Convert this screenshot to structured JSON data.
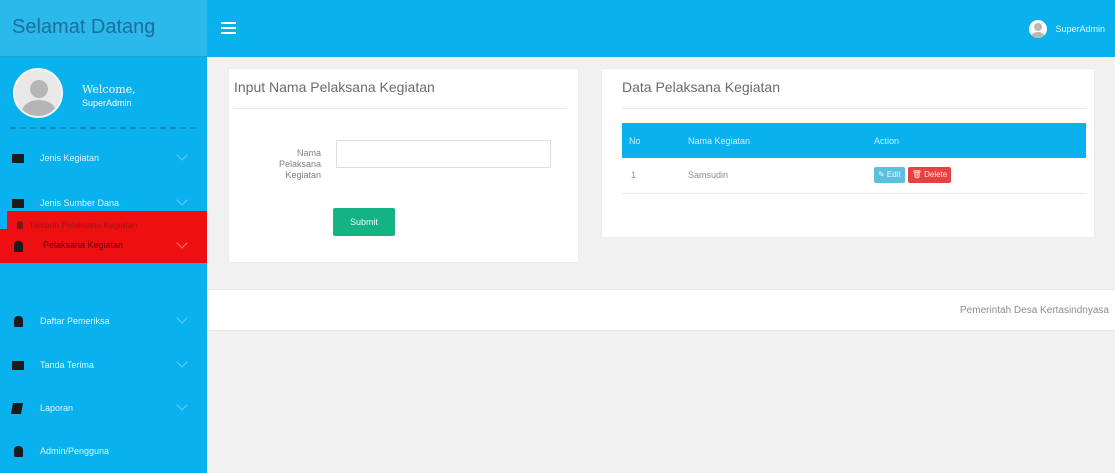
{
  "brand": {
    "title": "Selamat Datang"
  },
  "header": {
    "user_name": "SuperAdmin"
  },
  "sidebar": {
    "welcome": "Welcome,",
    "user_name": "SuperAdmin",
    "items": [
      {
        "label": "Jenis Kegiatan"
      },
      {
        "label": "Jenis Sumber Dana"
      },
      {
        "label": "Pelaksana Kegiatan"
      },
      {
        "label": "Daftar Pemeriksa"
      },
      {
        "label": "Tanda Terima"
      },
      {
        "label": "Laporan"
      },
      {
        "label": "Admin/Pengguna"
      }
    ],
    "subitem": {
      "label": "Tambah Pelaksana Kegiatan"
    }
  },
  "form_panel": {
    "title": "Input Nama Pelaksana Kegiatan",
    "field_label_1": "Nama",
    "field_label_2": "Pelaksana",
    "field_label_3": "Kegiatan",
    "field_value": "",
    "submit_label": "Submit"
  },
  "data_panel": {
    "title": "Data Pelaksana Kegiatan",
    "columns": [
      "No",
      "Nama Kegiatan",
      "Action"
    ],
    "rows": [
      {
        "no": "1",
        "name": "Samsudin",
        "edit": "✎ Edit",
        "delete": "🗑 Delete"
      }
    ]
  },
  "footer": {
    "text": "Pemerintah Desa Kertasindnyasa"
  },
  "colors": {
    "primary": "#09b1ee",
    "active": "#ee0f10",
    "submit": "#13b383",
    "edit": "#5bc0de",
    "delete": "#e94141"
  }
}
